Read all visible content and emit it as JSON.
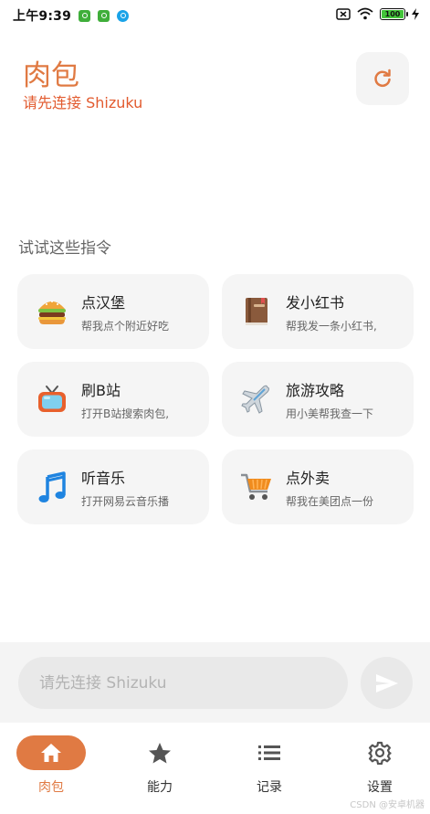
{
  "status_bar": {
    "time": "上午9:39",
    "battery": "100"
  },
  "header": {
    "title": "肉包",
    "subtitle": "请先连接 Shizuku"
  },
  "suggestions": {
    "title": "试试这些指令",
    "items": [
      {
        "title": "点汉堡",
        "subtitle": "帮我点个附近好吃",
        "icon": "hamburger-icon"
      },
      {
        "title": "发小红书",
        "subtitle": "帮我发一条小红书,",
        "icon": "book-icon"
      },
      {
        "title": "刷B站",
        "subtitle": "打开B站搜索肉包,",
        "icon": "tv-icon"
      },
      {
        "title": "旅游攻略",
        "subtitle": "用小美帮我查一下",
        "icon": "airplane-icon"
      },
      {
        "title": "听音乐",
        "subtitle": "打开网易云音乐播",
        "icon": "music-note-icon"
      },
      {
        "title": "点外卖",
        "subtitle": "帮我在美团点一份",
        "icon": "shopping-cart-icon"
      }
    ]
  },
  "input": {
    "placeholder": "请先连接 Shizuku"
  },
  "nav": {
    "items": [
      {
        "label": "肉包",
        "icon": "home-icon",
        "active": true
      },
      {
        "label": "能力",
        "icon": "star-icon",
        "active": false
      },
      {
        "label": "记录",
        "icon": "list-icon",
        "active": false
      },
      {
        "label": "设置",
        "icon": "gear-icon",
        "active": false
      }
    ]
  },
  "watermark": "CSDN @安卓机器",
  "colors": {
    "accent": "#e07a43",
    "warning": "#e25a2e"
  }
}
